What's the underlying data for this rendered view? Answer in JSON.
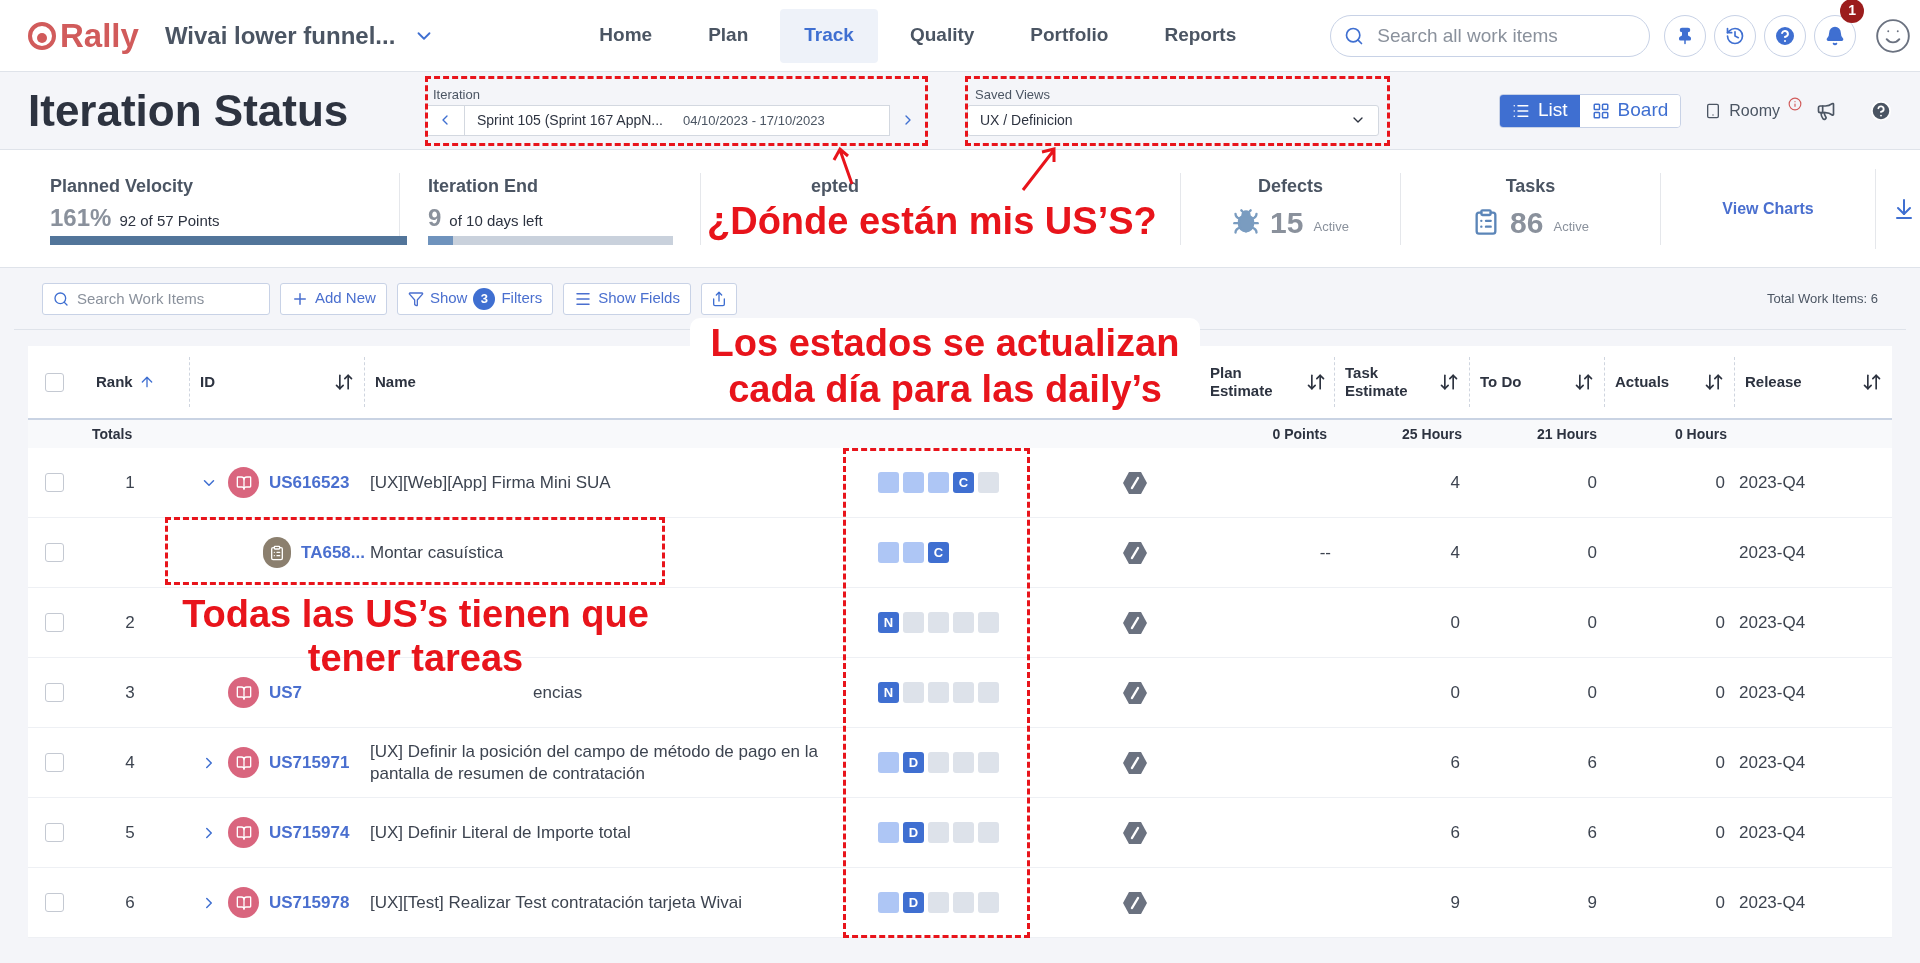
{
  "nav": {
    "logo": "Rally",
    "project": "Wivai lower funnel...",
    "tabs": [
      {
        "label": "Home",
        "selected": false
      },
      {
        "label": "Plan",
        "selected": false
      },
      {
        "label": "Track",
        "selected": true
      },
      {
        "label": "Quality",
        "selected": false
      },
      {
        "label": "Portfolio",
        "selected": false
      },
      {
        "label": "Reports",
        "selected": false
      }
    ],
    "search": {
      "placeholder": "Search all work items"
    },
    "notification_badge": "1"
  },
  "header": {
    "title": "Iteration Status",
    "iteration": {
      "label": "Iteration",
      "value": "Sprint 105 (Sprint 167 AppN...",
      "dates": "04/10/2023 - 17/10/2023"
    },
    "saved_views": {
      "label": "Saved Views",
      "value": "UX / Definicion"
    },
    "view_toggle": [
      {
        "label": "List",
        "selected": true
      },
      {
        "label": "Board",
        "selected": false
      }
    ],
    "roomy": "Roomy"
  },
  "metrics": {
    "planned_velocity": {
      "label": "Planned Velocity",
      "value": "161%",
      "detail": "92 of 57 Points",
      "level": 1
    },
    "iteration_end": {
      "label": "Iteration End",
      "value": "9",
      "detail": "of 10 days left",
      "level": 0.1
    },
    "partial_label": "epted",
    "defects": {
      "label": "Defects",
      "value": "15",
      "detail": "Active"
    },
    "tasks": {
      "label": "Tasks",
      "value": "86",
      "detail": "Active"
    },
    "view_charts": "View Charts"
  },
  "toolbar": {
    "search_placeholder": "Search Work Items",
    "add_new": "Add New",
    "show": "Show",
    "filter_count": "3",
    "filters": "Filters",
    "show_fields": "Show Fields",
    "total": "Total Work Items: 6"
  },
  "table": {
    "columns": [
      "Rank",
      "ID",
      "Name",
      "Plan Estimate",
      "Task Estimate",
      "To Do",
      "Actuals",
      "Release"
    ],
    "header_checked": false,
    "totals": {
      "label": "Totals",
      "plan_estimate": "0 Points",
      "task_estimate": "25 Hours",
      "to_do": "21 Hours",
      "actuals": "0 Hours"
    },
    "rows": [
      {
        "kind": "story",
        "checked": false,
        "rank": "1",
        "expanded": true,
        "id": "US616523",
        "name": "[UX][Web][App] Firma Mini SUA",
        "steps": [
          {
            "kind": "done"
          },
          {
            "kind": "done"
          },
          {
            "kind": "done"
          },
          {
            "kind": "current",
            "letter": "C"
          },
          {
            "kind": "todo"
          }
        ],
        "task_estimate": "4",
        "to_do": "0",
        "actuals": "0",
        "release": "2023-Q4",
        "children": [
          {
            "kind": "task",
            "checked": false,
            "id": "TA658...",
            "name": "Montar casuística",
            "steps": [
              {
                "kind": "done"
              },
              {
                "kind": "done"
              },
              {
                "kind": "current",
                "letter": "C"
              }
            ],
            "plan_estimate": "--",
            "task_estimate": "4",
            "to_do": "0",
            "release": "2023-Q4"
          }
        ]
      },
      {
        "kind": "hidden",
        "checked": false,
        "rank": "2",
        "steps": [
          {
            "kind": "current",
            "letter": "N"
          },
          {
            "kind": "todo"
          },
          {
            "kind": "todo"
          },
          {
            "kind": "todo"
          },
          {
            "kind": "todo"
          }
        ],
        "task_estimate": "0",
        "to_do": "0",
        "actuals": "0",
        "release": "2023-Q4"
      },
      {
        "kind": "story",
        "checked": false,
        "rank": "3",
        "id": "US7",
        "name": "encias",
        "name_covered_start": true,
        "steps": [
          {
            "kind": "current",
            "letter": "N"
          },
          {
            "kind": "todo"
          },
          {
            "kind": "todo"
          },
          {
            "kind": "todo"
          },
          {
            "kind": "todo"
          }
        ],
        "task_estimate": "0",
        "to_do": "0",
        "actuals": "0",
        "release": "2023-Q4"
      },
      {
        "kind": "story",
        "checked": false,
        "rank": "4",
        "expanded": false,
        "id": "US715971",
        "name": "[UX] Definir la posición del campo de método de pago en la pantalla de resumen de contratación",
        "steps": [
          {
            "kind": "done"
          },
          {
            "kind": "current",
            "letter": "D"
          },
          {
            "kind": "todo"
          },
          {
            "kind": "todo"
          },
          {
            "kind": "todo"
          }
        ],
        "task_estimate": "6",
        "to_do": "6",
        "actuals": "0",
        "release": "2023-Q4"
      },
      {
        "kind": "story",
        "checked": false,
        "rank": "5",
        "expanded": false,
        "id": "US715974",
        "name": "[UX] Definir Literal de Importe total",
        "steps": [
          {
            "kind": "done"
          },
          {
            "kind": "current",
            "letter": "D"
          },
          {
            "kind": "todo"
          },
          {
            "kind": "todo"
          },
          {
            "kind": "todo"
          }
        ],
        "task_estimate": "6",
        "to_do": "6",
        "actuals": "0",
        "release": "2023-Q4"
      },
      {
        "kind": "story",
        "checked": false,
        "rank": "6",
        "expanded": false,
        "id": "US715978",
        "name": "[UX][Test] Realizar Test contratación tarjeta Wivai",
        "steps": [
          {
            "kind": "done"
          },
          {
            "kind": "current",
            "letter": "D"
          },
          {
            "kind": "todo"
          },
          {
            "kind": "todo"
          },
          {
            "kind": "todo"
          }
        ],
        "task_estimate": "9",
        "to_do": "9",
        "actuals": "0",
        "release": "2023-Q4"
      }
    ]
  },
  "annotations": [
    "¿Dónde están mis US’S?",
    "Los estados se actualizan cada día para las daily’s",
    "Todas las US’s tienen que tener tareas"
  ]
}
